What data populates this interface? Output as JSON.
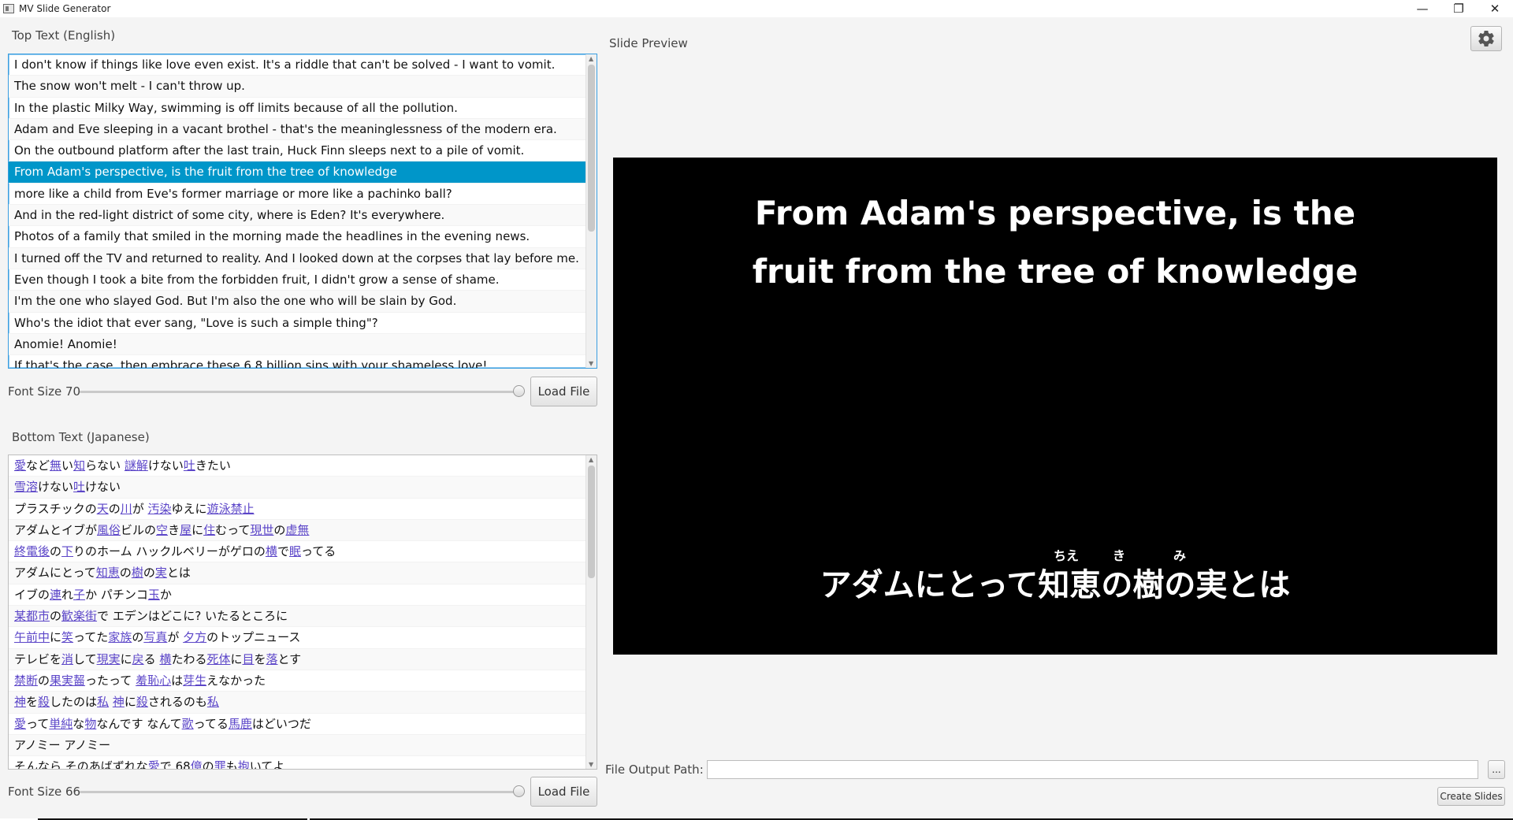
{
  "window": {
    "title": "MV Slide Generator",
    "minimize_glyph": "—",
    "restore_glyph": "❐",
    "close_glyph": "✕"
  },
  "top_panel": {
    "label": "Top Text (English)",
    "selected_index": 5,
    "items": [
      "I don't know if things like love even exist. It's a riddle that can't be solved - I want to vomit.",
      "The snow won't melt - I can't throw up.",
      "In the plastic Milky Way, swimming is off limits because of all the pollution.",
      "Adam and Eve sleeping in a vacant brothel - that's the meaninglessness of the modern era.",
      "On the outbound platform after the last train, Huck Finn sleeps next to a pile of vomit.",
      "From Adam's perspective, is the fruit from the tree of knowledge",
      "more like a child from Eve's former marriage or more like a pachinko ball?",
      "And in the red-light district of some city, where is Eden? It's everywhere.",
      "Photos of a family that smiled in the morning made the headlines in the evening news.",
      "I turned off the TV and returned to reality. And I looked down at the corpses that lay before me.",
      "Even though I took a bite from the forbidden fruit, I didn't grow a sense of shame.",
      "I'm the one who slayed God. But I'm also the one who will be slain by God.",
      "Who's the idiot that ever sang, \"Love is such a simple thing\"?",
      "Anomie! Anomie!",
      "If that's the case, then embrace these 6.8 billion sins with your shameless love!"
    ],
    "font_size_label": "Font Size 70",
    "font_size_value": 70,
    "load_button": "Load File"
  },
  "bottom_panel": {
    "label": "Bottom Text (Japanese)",
    "selected_index": 5,
    "items": [
      [
        [
          "愛",
          1
        ],
        [
          "など",
          0
        ],
        [
          "無",
          1
        ],
        [
          "い",
          0
        ],
        [
          "知",
          1
        ],
        [
          "らない ",
          0
        ],
        [
          "謎解",
          1
        ],
        [
          "けない",
          0
        ],
        [
          "吐",
          1
        ],
        [
          "きたい",
          0
        ]
      ],
      [
        [
          "雪溶",
          1
        ],
        [
          "けない",
          0
        ],
        [
          "吐",
          1
        ],
        [
          "けない",
          0
        ]
      ],
      [
        [
          "プラスチックの",
          0
        ],
        [
          "天",
          1
        ],
        [
          "の",
          0
        ],
        [
          "川",
          1
        ],
        [
          "が ",
          0
        ],
        [
          "汚染",
          1
        ],
        [
          "ゆえに",
          0
        ],
        [
          "遊泳禁止",
          1
        ]
      ],
      [
        [
          "アダムとイブが",
          0
        ],
        [
          "風俗",
          1
        ],
        [
          "ビルの",
          0
        ],
        [
          "空",
          1
        ],
        [
          "き",
          0
        ],
        [
          "屋",
          1
        ],
        [
          "に",
          0
        ],
        [
          "住",
          1
        ],
        [
          "むって",
          0
        ],
        [
          "現世",
          1
        ],
        [
          "の",
          0
        ],
        [
          "虚無",
          1
        ]
      ],
      [
        [
          "終電後",
          1
        ],
        [
          "の",
          0
        ],
        [
          "下",
          1
        ],
        [
          "りのホーム ハックルベリーがゲロの",
          0
        ],
        [
          "横",
          1
        ],
        [
          "で",
          0
        ],
        [
          "眠",
          1
        ],
        [
          "ってる",
          0
        ]
      ],
      [
        [
          "アダムにとって",
          0
        ],
        [
          "知恵",
          1
        ],
        [
          "の",
          0
        ],
        [
          "樹",
          1
        ],
        [
          "の",
          0
        ],
        [
          "実",
          1
        ],
        [
          "とは",
          0
        ]
      ],
      [
        [
          "イブの",
          0
        ],
        [
          "連",
          1
        ],
        [
          "れ",
          0
        ],
        [
          "子",
          1
        ],
        [
          "か パチンコ",
          0
        ],
        [
          "玉",
          1
        ],
        [
          "か",
          0
        ]
      ],
      [
        [
          "某都市",
          1
        ],
        [
          "の",
          0
        ],
        [
          "歓楽街",
          1
        ],
        [
          "で エデンはどこに? いたるところに",
          0
        ]
      ],
      [
        [
          "午前中",
          1
        ],
        [
          "に",
          0
        ],
        [
          "笑",
          1
        ],
        [
          "ってた",
          0
        ],
        [
          "家族",
          1
        ],
        [
          "の",
          0
        ],
        [
          "写真",
          1
        ],
        [
          "が ",
          0
        ],
        [
          "夕方",
          1
        ],
        [
          "のトップニュース",
          0
        ]
      ],
      [
        [
          "テレビを",
          0
        ],
        [
          "消",
          1
        ],
        [
          "して",
          0
        ],
        [
          "現実",
          1
        ],
        [
          "に",
          0
        ],
        [
          "戻",
          1
        ],
        [
          "る ",
          0
        ],
        [
          "横",
          1
        ],
        [
          "たわる",
          0
        ],
        [
          "死体",
          1
        ],
        [
          "に",
          0
        ],
        [
          "目",
          1
        ],
        [
          "を",
          0
        ],
        [
          "落",
          1
        ],
        [
          "とす",
          0
        ]
      ],
      [
        [
          "禁断",
          1
        ],
        [
          "の",
          0
        ],
        [
          "果実齧",
          1
        ],
        [
          "ったって ",
          0
        ],
        [
          "羞恥心",
          1
        ],
        [
          "は",
          0
        ],
        [
          "芽生",
          1
        ],
        [
          "えなかった",
          0
        ]
      ],
      [
        [
          "神",
          1
        ],
        [
          "を",
          0
        ],
        [
          "殺",
          1
        ],
        [
          "したのは",
          0
        ],
        [
          "私",
          1
        ],
        [
          " ",
          0
        ],
        [
          "神",
          1
        ],
        [
          "に",
          0
        ],
        [
          "殺",
          1
        ],
        [
          "されるのも",
          0
        ],
        [
          "私",
          1
        ]
      ],
      [
        [
          "愛",
          1
        ],
        [
          "って",
          0
        ],
        [
          "単純",
          1
        ],
        [
          "な",
          0
        ],
        [
          "物",
          1
        ],
        [
          "なんです なんて",
          0
        ],
        [
          "歌",
          1
        ],
        [
          "ってる",
          0
        ],
        [
          "馬鹿",
          1
        ],
        [
          "はどいつだ",
          0
        ]
      ],
      [
        [
          "アノミー アノミー",
          0
        ]
      ],
      [
        [
          "そんなら そのあばずれな",
          0
        ],
        [
          "愛",
          1
        ],
        [
          "で 68",
          0
        ],
        [
          "億",
          1
        ],
        [
          "の",
          0
        ],
        [
          "罪",
          1
        ],
        [
          "も",
          0
        ],
        [
          "抱",
          1
        ],
        [
          "いてよ",
          0
        ]
      ]
    ],
    "font_size_label": "Font Size 66",
    "font_size_value": 66,
    "load_button": "Load File"
  },
  "preview": {
    "label": "Slide Preview",
    "top_line1": "From Adam's perspective, is the",
    "top_line2": "fruit from the tree of knowledge",
    "bottom_text": "アダムにとって知恵の樹の実とは",
    "furigana": [
      "ちえ",
      "き",
      "み"
    ]
  },
  "output": {
    "label": "File Output Path:",
    "value": "",
    "browse_button": "...",
    "create_button": "Create Slides"
  },
  "colors": {
    "selection_blue": "#0096c9",
    "kanji_link": "#5b45c8",
    "preview_bg": "#000000"
  },
  "icons": {
    "settings": "gear-icon"
  }
}
